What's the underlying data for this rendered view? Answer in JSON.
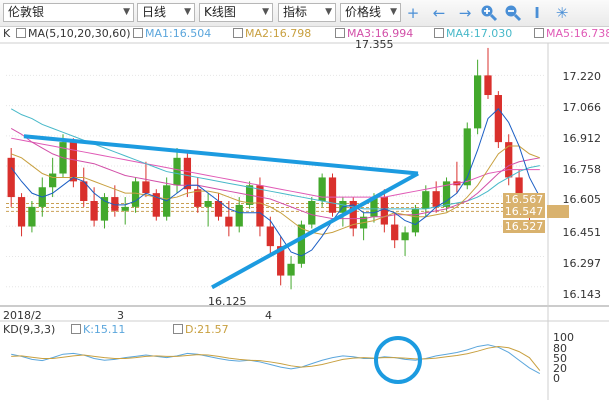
{
  "toolbar": {
    "symbol": "伦敦银",
    "period": "日线",
    "chart_style": "K线图",
    "indicator": "指标",
    "price_type": "价格线",
    "dropdown_arrow": "▼",
    "icons": [
      "crosshair-icon",
      "arrow-left-icon",
      "arrow-right-icon",
      "zoom-in-icon",
      "zoom-out-icon",
      "text-tool-icon",
      "settings-icon"
    ]
  },
  "legend": {
    "k_label": "K",
    "ma_label": "MA(5,10,20,30,60)",
    "ma1": "MA1:16.504",
    "ma2": "MA2:16.798",
    "ma3": "MA3:16.994",
    "ma4": "MA4:17.030",
    "ma5": "MA5:16.738"
  },
  "price_axis": [
    "17.220",
    "17.066",
    "16.912",
    "16.758",
    "16.605",
    "16.451",
    "16.297",
    "16.143"
  ],
  "price_tags": {
    "t1": "16.567",
    "t2": "16.547",
    "t3": "16.527"
  },
  "annotations": {
    "high": "17.355",
    "low": "16.125"
  },
  "date_axis": {
    "start": "2018/2",
    "m3": "3",
    "m4": "4"
  },
  "kd": {
    "label": "KD(9,3,3)",
    "k": "K:15.11",
    "d": "D:21.57",
    "axis": [
      "100",
      "80",
      "50",
      "20",
      "0"
    ]
  },
  "colors": {
    "up": "#43a82c",
    "down": "#d9302c",
    "trend": "#1c9be0",
    "ma1": "#1a5ec4",
    "ma2": "#c8a040",
    "ma3": "#d24fa8",
    "ma4": "#48b9c9",
    "ma5": "#e05ab6"
  },
  "chart_data": {
    "type": "candlestick",
    "ylim": [
      16.05,
      17.38
    ],
    "candles": [
      [
        16.8,
        16.85,
        16.55,
        16.6
      ],
      [
        16.6,
        16.62,
        16.4,
        16.45
      ],
      [
        16.45,
        16.58,
        16.42,
        16.55
      ],
      [
        16.55,
        16.7,
        16.5,
        16.65
      ],
      [
        16.65,
        16.8,
        16.6,
        16.72
      ],
      [
        16.72,
        16.92,
        16.7,
        16.88
      ],
      [
        16.88,
        16.9,
        16.65,
        16.68
      ],
      [
        16.68,
        16.75,
        16.55,
        16.58
      ],
      [
        16.58,
        16.65,
        16.45,
        16.48
      ],
      [
        16.48,
        16.62,
        16.44,
        16.6
      ],
      [
        16.6,
        16.66,
        16.5,
        16.53
      ],
      [
        16.53,
        16.6,
        16.46,
        16.55
      ],
      [
        16.55,
        16.7,
        16.52,
        16.68
      ],
      [
        16.68,
        16.78,
        16.6,
        16.62
      ],
      [
        16.62,
        16.64,
        16.48,
        16.5
      ],
      [
        16.5,
        16.7,
        16.48,
        16.66
      ],
      [
        16.66,
        16.85,
        16.62,
        16.8
      ],
      [
        16.8,
        16.84,
        16.6,
        16.64
      ],
      [
        16.64,
        16.7,
        16.52,
        16.55
      ],
      [
        16.55,
        16.62,
        16.45,
        16.58
      ],
      [
        16.58,
        16.62,
        16.48,
        16.5
      ],
      [
        16.5,
        16.58,
        16.4,
        16.45
      ],
      [
        16.45,
        16.6,
        16.42,
        16.56
      ],
      [
        16.56,
        16.68,
        16.54,
        16.66
      ],
      [
        16.66,
        16.7,
        16.4,
        16.45
      ],
      [
        16.45,
        16.5,
        16.3,
        16.35
      ],
      [
        16.35,
        16.4,
        16.15,
        16.2
      ],
      [
        16.2,
        16.3,
        16.13,
        16.26
      ],
      [
        16.26,
        16.48,
        16.24,
        16.46
      ],
      [
        16.46,
        16.6,
        16.44,
        16.58
      ],
      [
        16.58,
        16.72,
        16.55,
        16.7
      ],
      [
        16.7,
        16.72,
        16.5,
        16.52
      ],
      [
        16.52,
        16.6,
        16.45,
        16.58
      ],
      [
        16.58,
        16.6,
        16.4,
        16.44
      ],
      [
        16.44,
        16.52,
        16.38,
        16.5
      ],
      [
        16.5,
        16.62,
        16.47,
        16.6
      ],
      [
        16.6,
        16.64,
        16.42,
        16.46
      ],
      [
        16.46,
        16.52,
        16.34,
        16.38
      ],
      [
        16.38,
        16.45,
        16.3,
        16.42
      ],
      [
        16.42,
        16.56,
        16.4,
        16.54
      ],
      [
        16.54,
        16.66,
        16.5,
        16.63
      ],
      [
        16.63,
        16.68,
        16.52,
        16.55
      ],
      [
        16.55,
        16.7,
        16.53,
        16.68
      ],
      [
        16.68,
        16.78,
        16.62,
        16.66
      ],
      [
        16.66,
        16.98,
        16.64,
        16.95
      ],
      [
        16.95,
        17.3,
        16.92,
        17.22
      ],
      [
        17.22,
        17.36,
        17.1,
        17.12
      ],
      [
        17.12,
        17.14,
        16.85,
        16.88
      ],
      [
        16.88,
        16.92,
        16.66,
        16.7
      ],
      [
        16.7,
        16.74,
        16.55,
        16.58
      ],
      [
        16.58,
        16.6,
        16.48,
        16.53
      ],
      [
        16.53,
        16.57,
        16.5,
        16.55
      ]
    ],
    "trendlines": [
      {
        "from": [
          2,
          16.91
        ],
        "to": [
          51,
          16.72
        ]
      },
      {
        "from": [
          26,
          16.14
        ],
        "to": [
          51,
          16.72
        ]
      }
    ],
    "ma_lines": {
      "ma1": [
        16.75,
        16.68,
        16.62,
        16.6,
        16.62,
        16.66,
        16.7,
        16.68,
        16.62,
        16.58,
        16.56,
        16.56,
        16.58,
        16.62,
        16.6,
        16.58,
        16.62,
        16.66,
        16.66,
        16.62,
        16.58,
        16.54,
        16.52,
        16.52,
        16.52,
        16.48,
        16.4,
        16.32,
        16.3,
        16.33,
        16.4,
        16.48,
        16.55,
        16.56,
        16.52,
        16.52,
        16.54,
        16.52,
        16.48,
        16.46,
        16.5,
        16.55,
        16.58,
        16.62,
        16.7,
        16.84,
        17.0,
        17.05,
        16.98,
        16.86,
        16.7,
        16.6
      ],
      "ma2": [
        16.82,
        16.8,
        16.76,
        16.72,
        16.7,
        16.7,
        16.7,
        16.7,
        16.68,
        16.66,
        16.64,
        16.62,
        16.62,
        16.61,
        16.6,
        16.59,
        16.6,
        16.62,
        16.63,
        16.63,
        16.62,
        16.6,
        16.58,
        16.57,
        16.57,
        16.55,
        16.52,
        16.48,
        16.44,
        16.42,
        16.41,
        16.42,
        16.44,
        16.46,
        16.47,
        16.48,
        16.5,
        16.52,
        16.51,
        16.5,
        16.5,
        16.51,
        16.52,
        16.55,
        16.6,
        16.66,
        16.74,
        16.82,
        16.86,
        16.86,
        16.82,
        16.8
      ],
      "ma3": [
        16.95,
        16.92,
        16.88,
        16.85,
        16.82,
        16.8,
        16.79,
        16.78,
        16.77,
        16.75,
        16.73,
        16.71,
        16.7,
        16.69,
        16.68,
        16.67,
        16.66,
        16.66,
        16.66,
        16.65,
        16.64,
        16.63,
        16.62,
        16.61,
        16.6,
        16.59,
        16.57,
        16.55,
        16.53,
        16.51,
        16.5,
        16.49,
        16.49,
        16.49,
        16.49,
        16.5,
        16.5,
        16.51,
        16.51,
        16.51,
        16.52,
        16.53,
        16.54,
        16.56,
        16.58,
        16.62,
        16.67,
        16.72,
        16.76,
        16.78,
        16.79,
        16.8
      ],
      "ma4": [
        17.05,
        17.02,
        17.0,
        16.97,
        16.95,
        16.93,
        16.91,
        16.89,
        16.87,
        16.85,
        16.83,
        16.81,
        16.79,
        16.77,
        16.75,
        16.73,
        16.72,
        16.71,
        16.7,
        16.69,
        16.68,
        16.67,
        16.66,
        16.65,
        16.64,
        16.63,
        16.62,
        16.61,
        16.6,
        16.59,
        16.58,
        16.57,
        16.56,
        16.55,
        16.54,
        16.54,
        16.54,
        16.54,
        16.54,
        16.54,
        16.54,
        16.55,
        16.56,
        16.57,
        16.58,
        16.6,
        16.63,
        16.67,
        16.7,
        16.73,
        16.75,
        16.76
      ],
      "ma5": [
        16.9,
        16.89,
        16.88,
        16.87,
        16.86,
        16.85,
        16.84,
        16.83,
        16.82,
        16.81,
        16.8,
        16.79,
        16.78,
        16.77,
        16.76,
        16.75,
        16.74,
        16.73,
        16.72,
        16.71,
        16.7,
        16.69,
        16.68,
        16.67,
        16.66,
        16.65,
        16.64,
        16.63,
        16.62,
        16.61,
        16.6,
        16.6,
        16.6,
        16.6,
        16.6,
        16.6,
        16.6,
        16.61,
        16.62,
        16.63,
        16.64,
        16.65,
        16.66,
        16.67,
        16.68,
        16.7,
        16.72,
        16.73,
        16.74,
        16.74,
        16.74,
        16.74
      ]
    },
    "kd_series": {
      "k": [
        60,
        55,
        48,
        45,
        52,
        60,
        62,
        58,
        50,
        46,
        48,
        52,
        55,
        58,
        55,
        52,
        56,
        62,
        60,
        55,
        50,
        46,
        44,
        46,
        42,
        36,
        30,
        26,
        30,
        38,
        46,
        52,
        56,
        54,
        50,
        50,
        54,
        52,
        48,
        46,
        50,
        56,
        60,
        64,
        70,
        78,
        82,
        76,
        64,
        46,
        28,
        15
      ],
      "d": [
        55,
        56,
        53,
        50,
        50,
        53,
        56,
        58,
        55,
        52,
        50,
        50,
        52,
        55,
        56,
        55,
        55,
        57,
        59,
        58,
        55,
        51,
        48,
        46,
        45,
        42,
        38,
        33,
        30,
        32,
        36,
        42,
        48,
        51,
        52,
        51,
        52,
        52,
        51,
        49,
        49,
        51,
        54,
        57,
        61,
        67,
        74,
        78,
        75,
        66,
        52,
        22
      ]
    }
  }
}
